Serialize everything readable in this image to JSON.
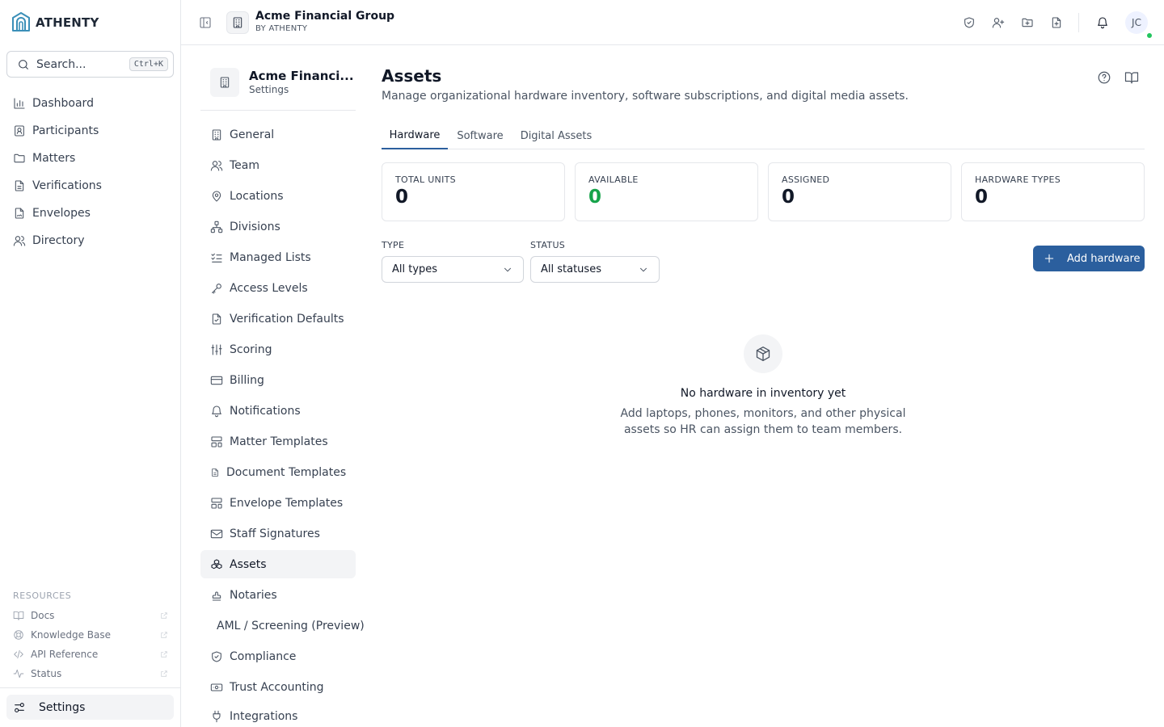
{
  "brand": {
    "name": "ATHENTY"
  },
  "search": {
    "placeholder": "Search...",
    "shortcut": "Ctrl+K"
  },
  "sidebar": {
    "items": [
      {
        "label": "Dashboard",
        "icon": "bar-chart-icon"
      },
      {
        "label": "Participants",
        "icon": "contact-icon"
      },
      {
        "label": "Matters",
        "icon": "folder-icon"
      },
      {
        "label": "Verifications",
        "icon": "file-text-icon"
      },
      {
        "label": "Envelopes",
        "icon": "file-signature-icon"
      },
      {
        "label": "Directory",
        "icon": "users-icon"
      }
    ],
    "resources_title": "RESOURCES",
    "resources": [
      {
        "label": "Docs",
        "icon": "book-icon"
      },
      {
        "label": "Knowledge Base",
        "icon": "lifebuoy-icon"
      },
      {
        "label": "API Reference",
        "icon": "code-icon"
      },
      {
        "label": "Status",
        "icon": "activity-icon"
      }
    ],
    "settings_label": "Settings"
  },
  "header": {
    "org_name": "Acme Financial Group",
    "org_sub": "BY ATHENTY",
    "user_initials": "JC"
  },
  "settings_nav": {
    "org_name": "Acme Financi...",
    "subtitle": "Settings",
    "items": [
      {
        "label": "General",
        "icon": "building-icon"
      },
      {
        "label": "Team",
        "icon": "users-icon"
      },
      {
        "label": "Locations",
        "icon": "map-pin-icon"
      },
      {
        "label": "Divisions",
        "icon": "network-icon"
      },
      {
        "label": "Managed Lists",
        "icon": "list-checks-icon"
      },
      {
        "label": "Access Levels",
        "icon": "key-icon"
      },
      {
        "label": "Verification Defaults",
        "icon": "file-check-icon"
      },
      {
        "label": "Scoring",
        "icon": "sliders-icon"
      },
      {
        "label": "Billing",
        "icon": "credit-card-icon"
      },
      {
        "label": "Notifications",
        "icon": "bell-icon"
      },
      {
        "label": "Matter Templates",
        "icon": "layout-template-icon"
      },
      {
        "label": "Document Templates",
        "icon": "file-icon"
      },
      {
        "label": "Envelope Templates",
        "icon": "layout-template-icon"
      },
      {
        "label": "Staff Signatures",
        "icon": "mail-icon"
      },
      {
        "label": "Assets",
        "icon": "boxes-icon",
        "active": true
      },
      {
        "label": "Notaries",
        "icon": "stamp-icon"
      },
      {
        "label": "AML / Screening (Preview)",
        "icon": ""
      },
      {
        "label": "Compliance",
        "icon": "shield-check-icon"
      },
      {
        "label": "Trust Accounting",
        "icon": "banknote-icon"
      },
      {
        "label": "Integrations",
        "icon": "plug-icon"
      }
    ]
  },
  "main": {
    "title": "Assets",
    "description": "Manage organizational hardware inventory, software subscriptions, and digital media assets.",
    "tabs": [
      {
        "label": "Hardware",
        "active": true
      },
      {
        "label": "Software"
      },
      {
        "label": "Digital Assets"
      }
    ],
    "stats": [
      {
        "label": "TOTAL UNITS",
        "value": "0"
      },
      {
        "label": "AVAILABLE",
        "value": "0",
        "color": "#16a34a"
      },
      {
        "label": "ASSIGNED",
        "value": "0"
      },
      {
        "label": "HARDWARE TYPES",
        "value": "0"
      }
    ],
    "filters": {
      "type_label": "TYPE",
      "type_value": "All types",
      "status_label": "STATUS",
      "status_value": "All statuses"
    },
    "add_button": "Add hardware",
    "empty": {
      "title": "No hardware in inventory yet",
      "description": "Add laptops, phones, monitors, and other physical assets so HR can assign them to team members."
    }
  },
  "colors": {
    "accent": "#2b5f9e",
    "available": "#16a34a",
    "online": "#22c55e"
  }
}
